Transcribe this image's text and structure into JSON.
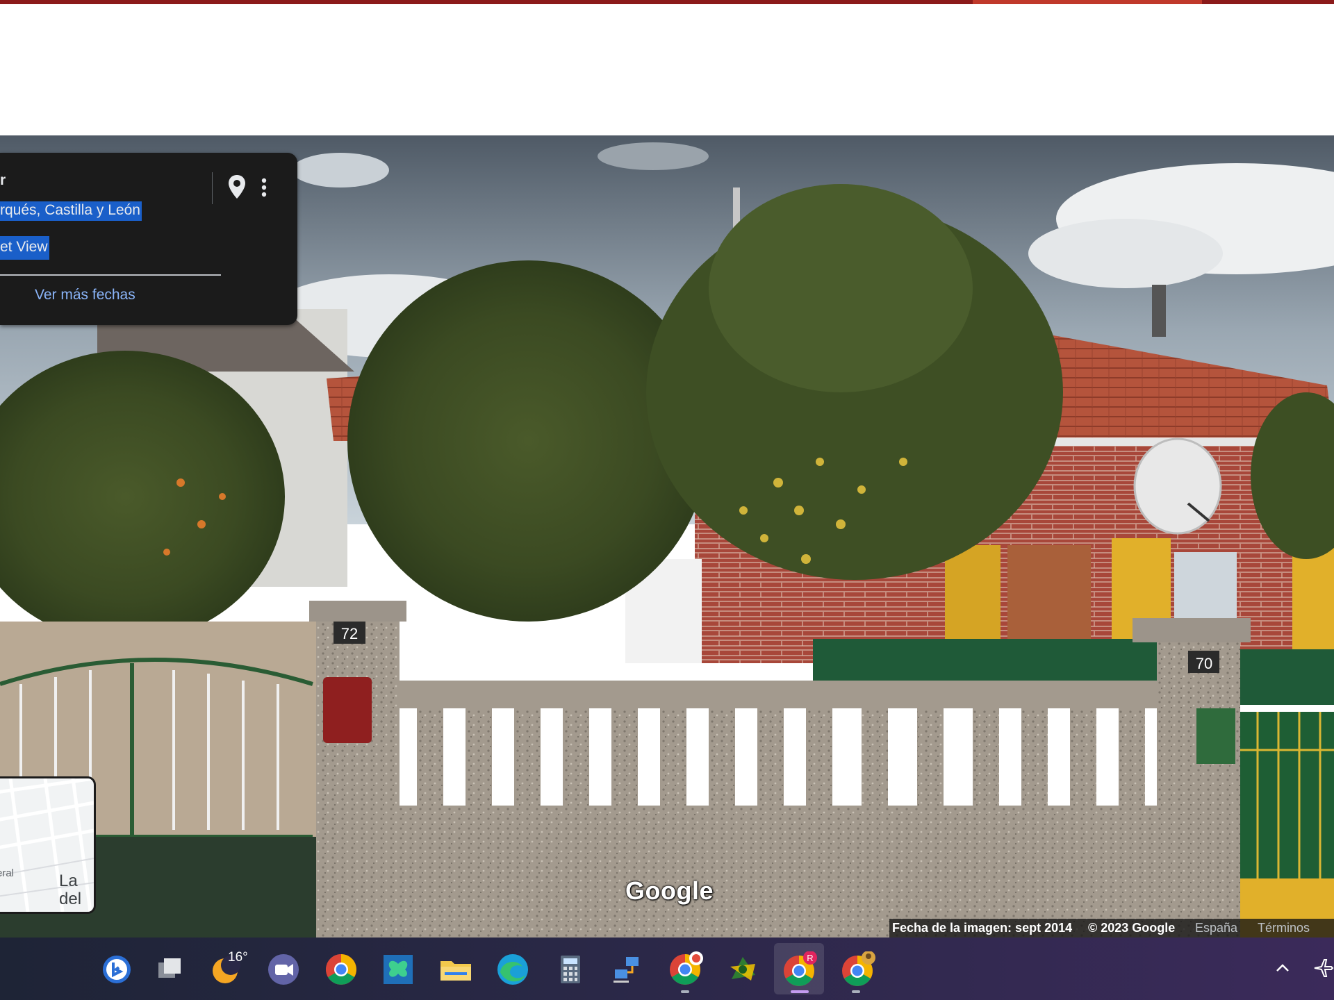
{
  "colors": {
    "top_accent": "#8b1a1a",
    "info_card_bg": "#1b1b1b",
    "selection": "#1a5fc9",
    "link": "#8ab4f8",
    "taskbar": "#2a2847"
  },
  "info_card": {
    "title": "r",
    "region": "rqués, Castilla y León",
    "street_view_label": "et View",
    "more_dates_link": "Ver más fechas",
    "icons": [
      "location-pin-icon",
      "more-vert-icon"
    ]
  },
  "minimap": {
    "label_left": "eral",
    "label_right_line1": "La",
    "label_right_line2": "del"
  },
  "street_view": {
    "house_number_left": "72",
    "house_number_right": "70",
    "watermark": "Google"
  },
  "attribution": {
    "image_date": "Fecha de la imagen: sept 2014",
    "copyright": "© 2023 Google",
    "country": "España",
    "terms": "Términos"
  },
  "taskbar": {
    "weather_temp": "16°",
    "apps": [
      "bing-icon",
      "task-view-icon",
      "weather-icon",
      "meet-icon",
      "chrome-icon",
      "butterfly-app-icon",
      "file-explorer-icon",
      "edge-icon",
      "calculator-icon",
      "network-app-icon",
      "chrome-profile-icon",
      "spreadsheet-app-icon",
      "chrome-r-profile-icon",
      "chrome-alt-profile-icon"
    ],
    "chrome_r_badge": "R",
    "tray_icons": [
      "tray-chevron-up-icon",
      "airplane-mode-icon"
    ]
  }
}
